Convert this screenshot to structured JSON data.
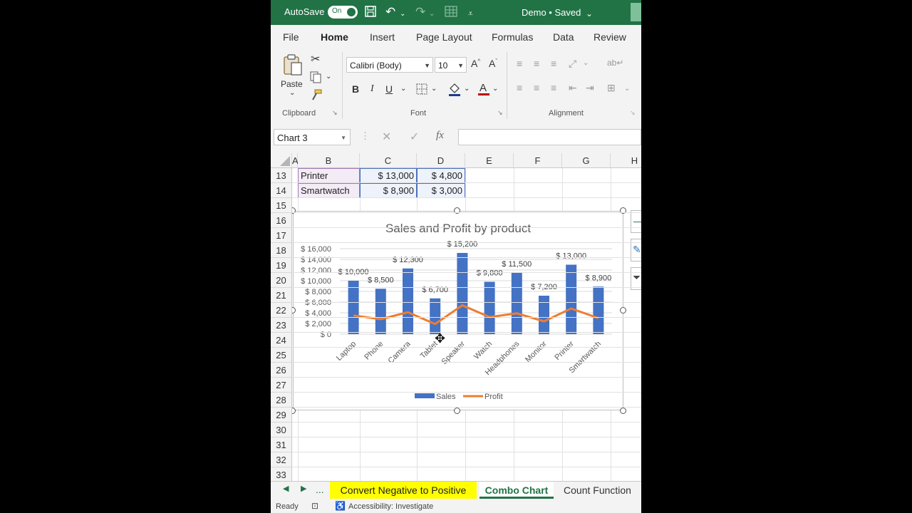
{
  "titlebar": {
    "autosave_label": "AutoSave",
    "toggle_label": "On",
    "document": "Demo • Saved"
  },
  "ribbon_tabs": [
    "File",
    "Home",
    "Insert",
    "Page Layout",
    "Formulas",
    "Data",
    "Review"
  ],
  "ribbon": {
    "paste_label": "Paste",
    "font_name": "Calibri (Body)",
    "font_size": "10",
    "bold": "B",
    "italic": "I",
    "underline": "U",
    "groups": {
      "clipboard": "Clipboard",
      "font": "Font",
      "alignment": "Alignment"
    }
  },
  "formula_bar": {
    "name_box": "Chart 3",
    "fx": "fx",
    "value": ""
  },
  "columns": [
    "A",
    "B",
    "C",
    "D",
    "E",
    "F",
    "G",
    "H"
  ],
  "rows": [
    "13",
    "14",
    "15",
    "16",
    "17",
    "18",
    "19",
    "20",
    "21",
    "22",
    "23",
    "24",
    "25",
    "26",
    "27",
    "28",
    "29",
    "30",
    "31",
    "32",
    "33"
  ],
  "table_rows": [
    {
      "product": "Printer",
      "sales": "$ 13,000",
      "profit": "$ 4,800"
    },
    {
      "product": "Smartwatch",
      "sales": "$ 8,900",
      "profit": "$ 3,000"
    }
  ],
  "chart_data": {
    "type": "bar",
    "title": "Sales and Profit by product",
    "categories": [
      "Laptop",
      "Phone",
      "Camera",
      "Tablet",
      "Speaker",
      "Watch",
      "Headphones",
      "Monitor",
      "Printer",
      "Smartwatch"
    ],
    "series": [
      {
        "name": "Sales",
        "type": "bar",
        "color": "#4472c4",
        "values": [
          10000,
          8500,
          12300,
          6700,
          15200,
          9800,
          11500,
          7200,
          13000,
          8900
        ]
      },
      {
        "name": "Profit",
        "type": "line",
        "color": "#ed7d31",
        "values": [
          3500,
          2800,
          4100,
          1900,
          5400,
          3200,
          3900,
          2400,
          4800,
          3000
        ]
      }
    ],
    "data_labels": [
      "$ 10,000",
      "$ 8,500",
      "$ 12,300",
      "$ 6,700",
      "$ 15,200",
      "$ 9,800",
      "$ 11,500",
      "$ 7,200",
      "$ 13,000",
      "$ 8,900"
    ],
    "y_ticks": [
      "$ 0",
      "$ 2,000",
      "$ 4,000",
      "$ 6,000",
      "$ 8,000",
      "$ 10,000",
      "$ 12,000",
      "$ 14,000",
      "$ 16,000"
    ],
    "ylim": [
      0,
      16000
    ],
    "grid": true,
    "legend": "bottom"
  },
  "sheet_tabs": {
    "nav_more": "...",
    "tab1": "Convert Negative to Positive",
    "tab2": "Combo Chart",
    "tab3": "Count Function"
  },
  "status": {
    "ready": "Ready",
    "accessibility": "Accessibility: Investigate"
  }
}
